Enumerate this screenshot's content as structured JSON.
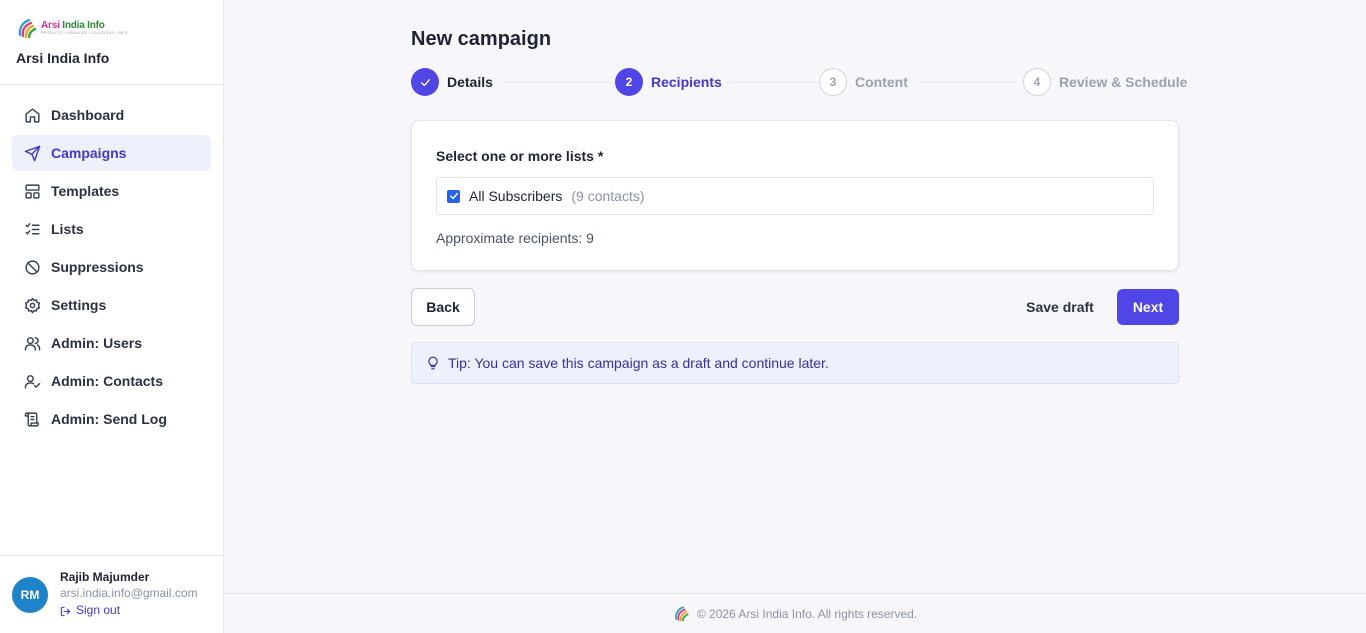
{
  "brand": {
    "logo_word_1": "Arsi ",
    "logo_word_2": "India Info",
    "logo_sub": "PRODUCTS • SERVICES • SOLUTIONS • INFO",
    "name": "Arsi India Info"
  },
  "sidebar": {
    "items": [
      {
        "label": "Dashboard",
        "icon": "home-icon"
      },
      {
        "label": "Campaigns",
        "icon": "send-icon",
        "active": true
      },
      {
        "label": "Templates",
        "icon": "layout-icon"
      },
      {
        "label": "Lists",
        "icon": "list-checks-icon"
      },
      {
        "label": "Suppressions",
        "icon": "ban-icon"
      },
      {
        "label": "Settings",
        "icon": "gear-icon"
      },
      {
        "label": "Admin: Users",
        "icon": "users-icon"
      },
      {
        "label": "Admin: Contacts",
        "icon": "user-check-icon"
      },
      {
        "label": "Admin: Send Log",
        "icon": "scroll-icon"
      }
    ]
  },
  "user": {
    "initials": "RM",
    "name": "Rajib Majumder",
    "email": "arsi.india.info@gmail.com",
    "signout_label": "Sign out"
  },
  "page": {
    "title": "New campaign"
  },
  "stepper": {
    "steps": [
      {
        "number": "1",
        "label": "Details",
        "state": "done"
      },
      {
        "number": "2",
        "label": "Recipients",
        "state": "current"
      },
      {
        "number": "3",
        "label": "Content",
        "state": "pending"
      },
      {
        "number": "4",
        "label": "Review & Schedule",
        "state": "pending"
      }
    ]
  },
  "recipients": {
    "select_label": "Select one or more lists *",
    "lists": [
      {
        "name": "All Subscribers",
        "count": "(9 contacts)",
        "checked": true
      }
    ],
    "approx_text": "Approximate recipients: 9"
  },
  "actions": {
    "back_label": "Back",
    "save_draft_label": "Save draft",
    "next_label": "Next"
  },
  "tip": {
    "text": "Tip: You can save this campaign as a draft and continue later."
  },
  "footer": {
    "text": "© 2026 Arsi India Info. All rights reserved."
  },
  "colors": {
    "accent": "#4f46e5",
    "accent_text": "#4338ca",
    "avatar": "#1e83c8",
    "checkbox": "#2563eb"
  }
}
